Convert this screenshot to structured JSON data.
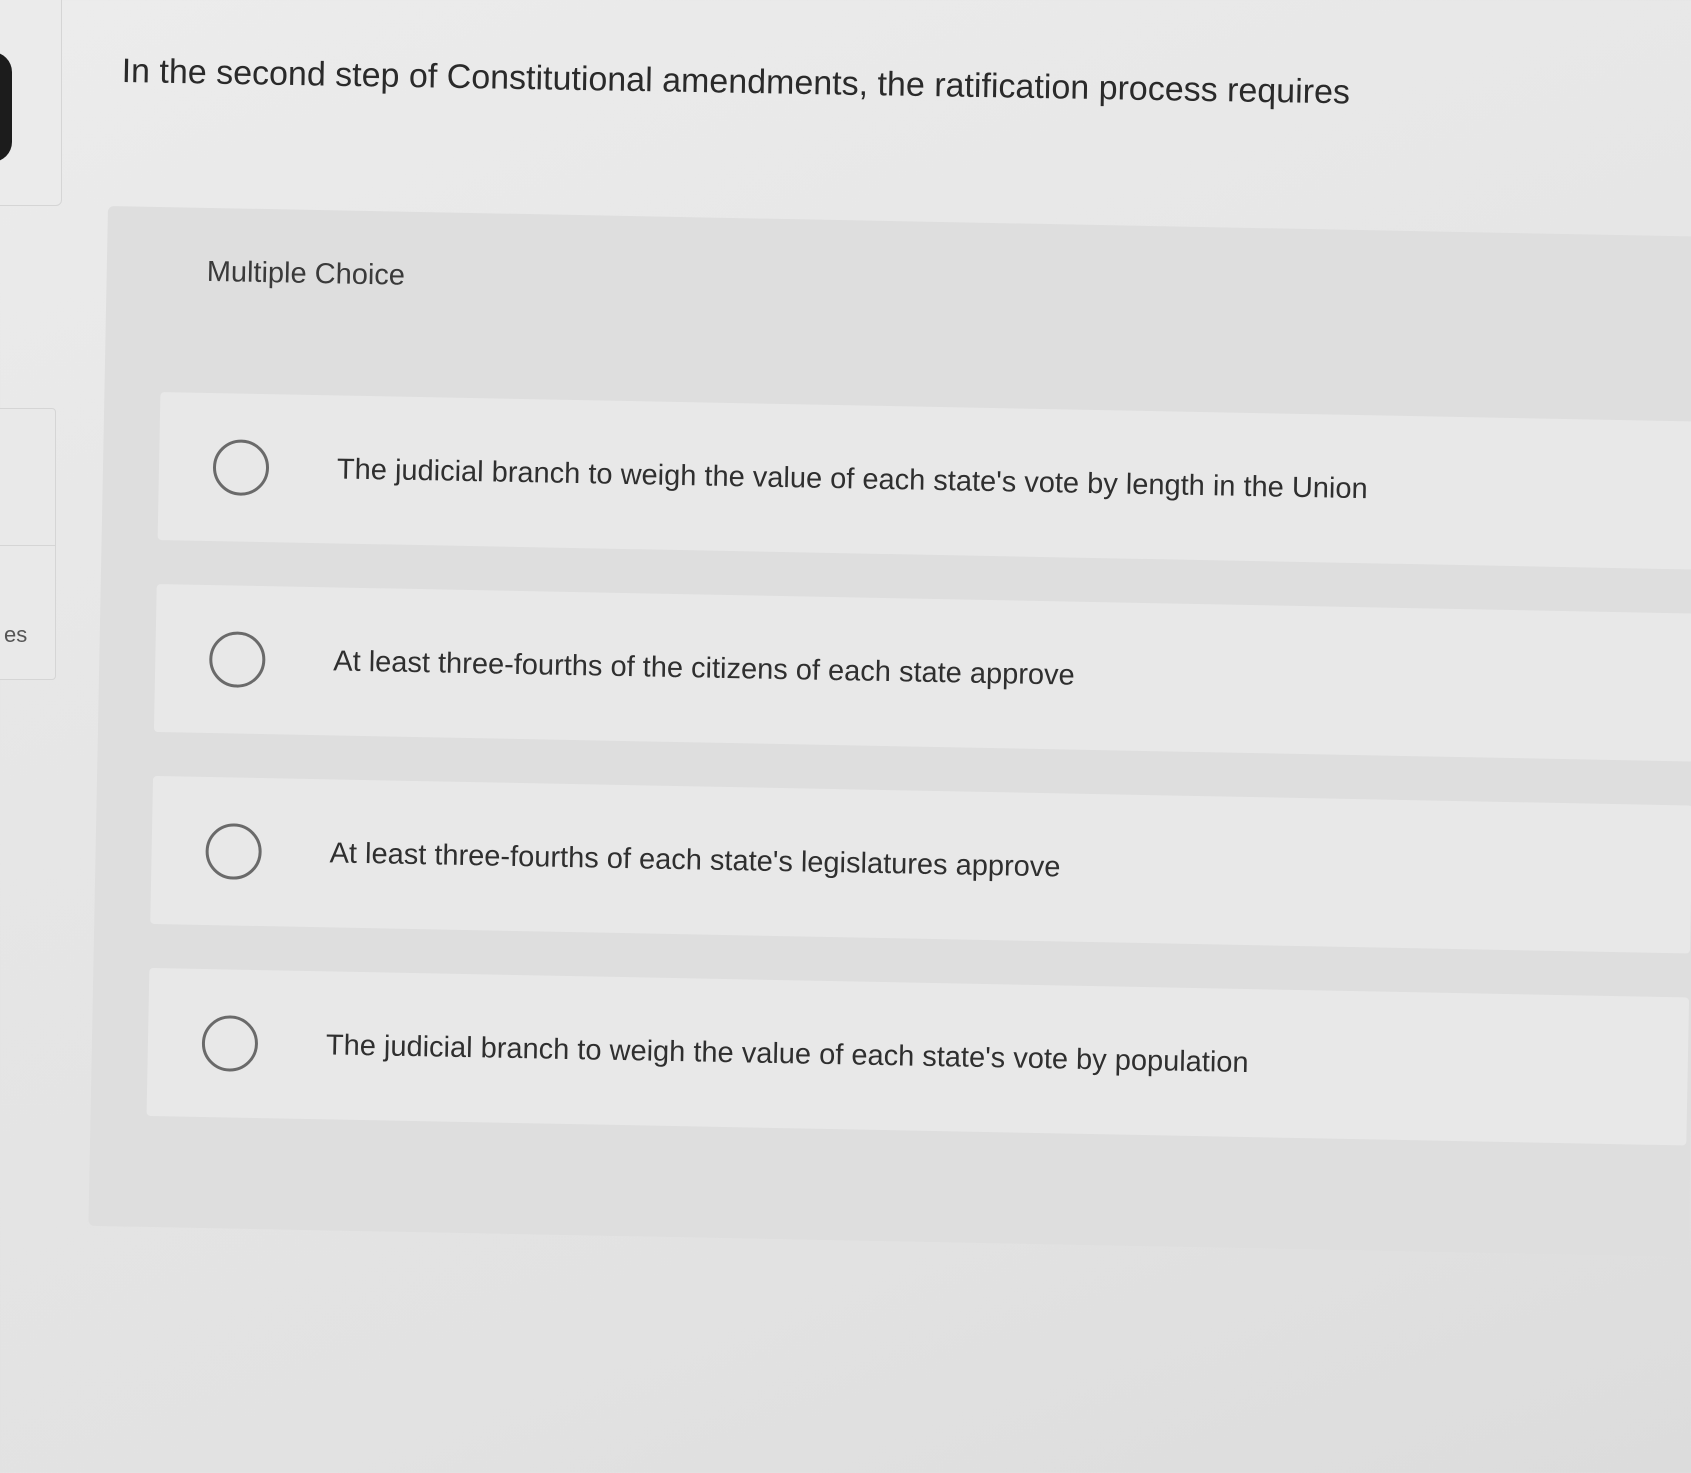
{
  "sidebar": {
    "partial_label": "es"
  },
  "question": {
    "prompt": "In the second step of Constitutional amendments, the ratification process requires"
  },
  "answer_panel": {
    "type_label": "Multiple Choice",
    "options": [
      {
        "label": "The judicial branch to weigh the value of each state's vote by length in the Union",
        "selected": false
      },
      {
        "label": "At least three-fourths of the citizens of each state approve",
        "selected": false
      },
      {
        "label": "At least three-fourths of each state's legislatures approve",
        "selected": false
      },
      {
        "label": "The judicial branch to weigh the value of each state's vote by population",
        "selected": false
      }
    ]
  }
}
